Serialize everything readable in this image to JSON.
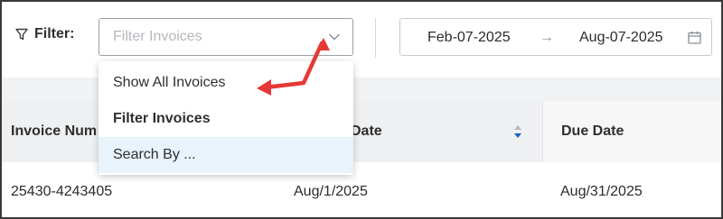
{
  "filter": {
    "label": "Filter:",
    "select_placeholder": "Filter Invoices"
  },
  "date_range": {
    "start": "Feb-07-2025",
    "separator": "→",
    "end": "Aug-07-2025"
  },
  "dropdown": {
    "items": [
      {
        "label": "Show All Invoices",
        "selected": false,
        "highlighted": false
      },
      {
        "label": "Filter Invoices",
        "selected": true,
        "highlighted": false
      },
      {
        "label": "Search By ...",
        "selected": false,
        "highlighted": true
      }
    ]
  },
  "table": {
    "columns": [
      "Invoice Num",
      "Date",
      "Due Date"
    ],
    "rows": [
      [
        "25430-4243405",
        "Aug/1/2025",
        "Aug/31/2025"
      ]
    ]
  },
  "colors": {
    "annotation_arrow": "#e53935",
    "highlight_row": "#e8f3fb",
    "sort_active": "#1565c0"
  },
  "icons": {
    "filter": "funnel-icon",
    "select_chevron": "chevron-down-icon",
    "calendar": "calendar-icon",
    "sort": "sort-icon"
  }
}
